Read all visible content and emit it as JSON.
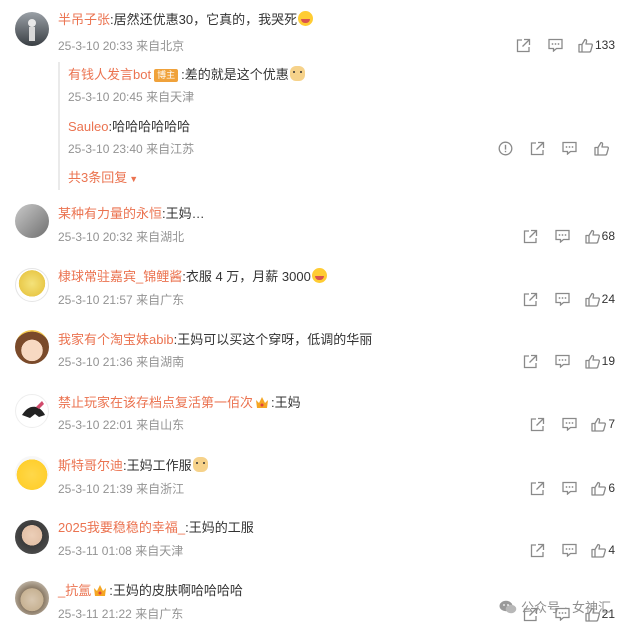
{
  "comments": [
    {
      "username": "半吊子张",
      "text": ":居然还优惠30，它真的，我哭死",
      "time": "25-3-10 20:33",
      "location": "来自北京",
      "likes": "133",
      "replies": [
        {
          "username": "有钱人发言bot",
          "badge": "博主",
          "text": ":差的就是这个优惠",
          "time": "25-3-10 20:45",
          "location": "来自天津"
        },
        {
          "username": "Sauleo",
          "text": ":哈哈哈哈哈哈",
          "time": "25-3-10 23:40",
          "location": "来自江苏"
        }
      ],
      "more_replies": "共3条回复"
    },
    {
      "username": "某种有力量的永恒",
      "text": ":王妈…",
      "time": "25-3-10 20:32",
      "location": "来自湖北",
      "likes": "68"
    },
    {
      "username": "棣球常驻嘉宾_锦鲤酱",
      "text": ":衣服 4 万，月薪 3000",
      "time": "25-3-10 21:57",
      "location": "来自广东",
      "likes": "24"
    },
    {
      "username": "我家有个淘宝妹abib",
      "text": ":王妈可以买这个穿呀，低调的华丽",
      "time": "25-3-10 21:36",
      "location": "来自湖南",
      "likes": "19"
    },
    {
      "username": "禁止玩家在该存档点复活第一佰次",
      "text": ":王妈",
      "time": "25-3-10 22:01",
      "location": "来自山东",
      "likes": "7"
    },
    {
      "username": "斯特哥尔迪",
      "text": ":王妈工作服",
      "time": "25-3-10 21:39",
      "location": "来自浙江",
      "likes": "6"
    },
    {
      "username": "2025我要稳稳的幸福_",
      "text": ":王妈的工服",
      "time": "25-3-11 01:08",
      "location": "来自天津",
      "likes": "4"
    },
    {
      "username": "_抗氲",
      "text": ":王妈的皮肤啊哈哈哈哈",
      "time": "25-3-11 21:22",
      "location": "来自广东",
      "likes": "21"
    }
  ],
  "watermark": {
    "dot": "公众号 ·",
    "name": "女神汇"
  },
  "colors": {
    "username": "#eb7350",
    "meta": "#939393",
    "icon": "#8a8a8a"
  }
}
